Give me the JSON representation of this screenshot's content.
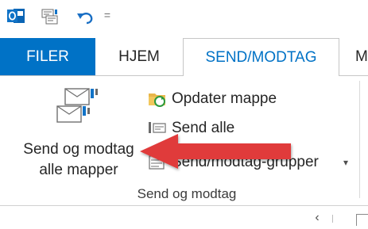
{
  "quick_access": {
    "icons": [
      "outlook-icon",
      "send-receive-all-icon",
      "undo-icon",
      "customize-toolbar-icon"
    ],
    "more_glyph": "="
  },
  "tabs": {
    "file": "FILER",
    "home": "HJEM",
    "send_receive": "SEND/MODTAG",
    "next_partial": "M",
    "active": "send_receive"
  },
  "ribbon": {
    "big_button": {
      "line1": "Send og modtag",
      "line2": "alle mapper",
      "icon": "send-receive-all-folders-icon"
    },
    "update_folder": {
      "label": "Opdater mappe",
      "icon": "update-folder-icon"
    },
    "send_all": {
      "label": "Send alle",
      "icon": "send-all-icon"
    },
    "send_receive_groups": {
      "label": "Send/modtag-grupper",
      "icon": "send-receive-groups-icon",
      "dropdown": "▾"
    },
    "group_label": "Send og modtag"
  },
  "lower_strip": {
    "collapse_glyph": "‹"
  },
  "colors": {
    "file_tab_bg": "#0072c6",
    "active_tab_text": "#0072c6",
    "annotation_arrow": "#e03a3a"
  }
}
